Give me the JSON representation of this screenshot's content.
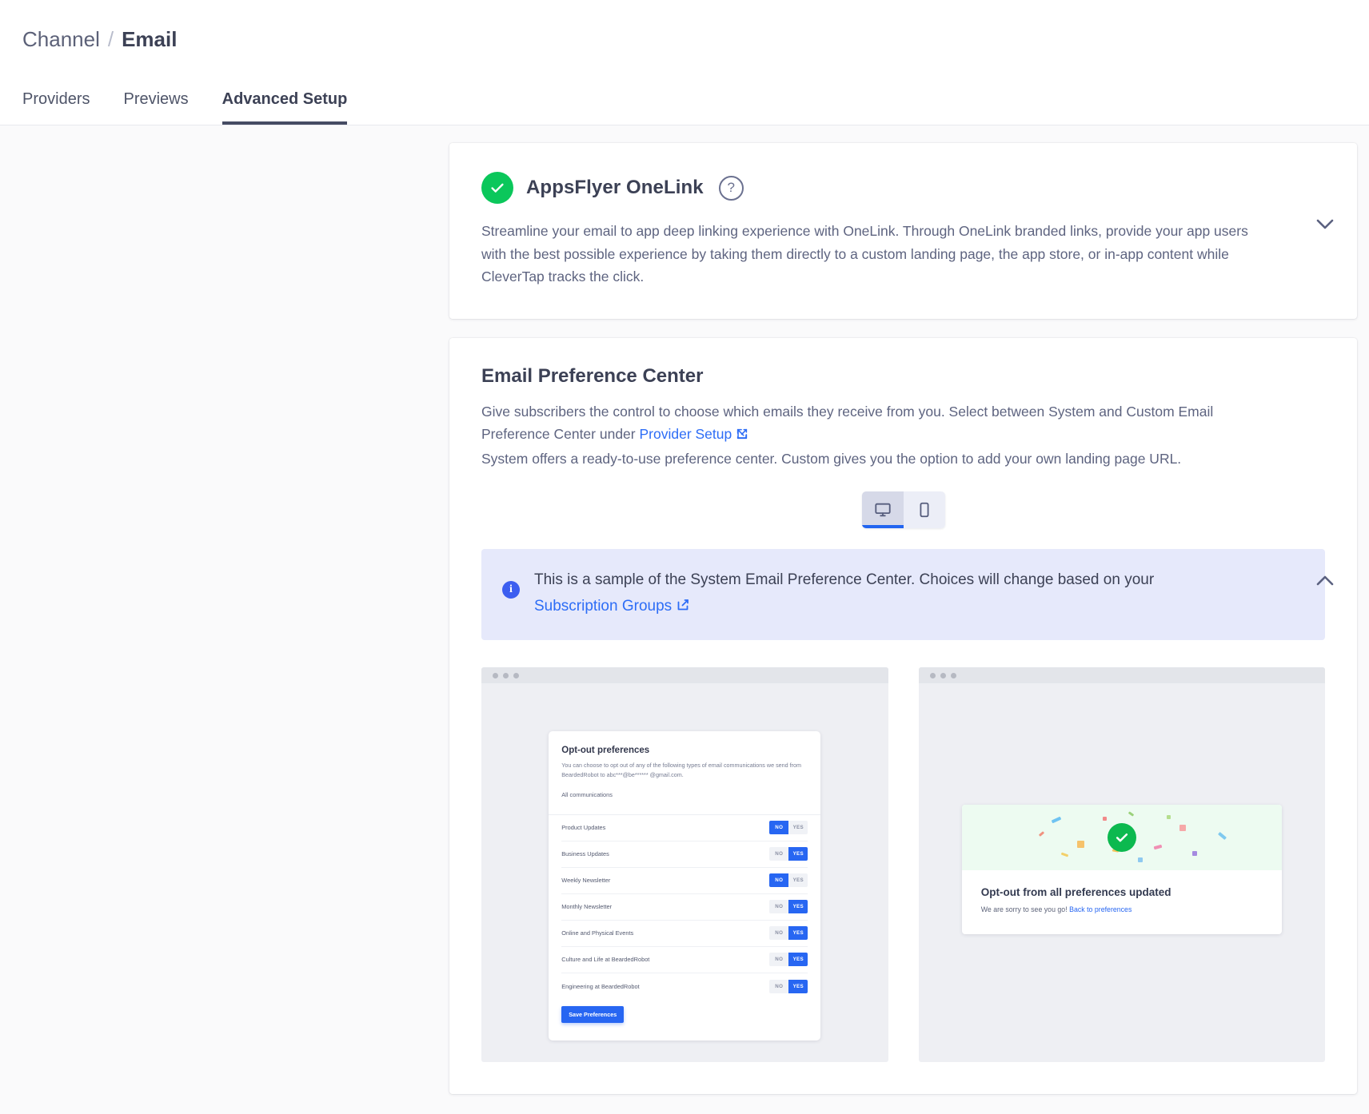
{
  "breadcrumb": {
    "parent": "Channel",
    "separator": "/",
    "current": "Email"
  },
  "tabs": [
    {
      "label": "Providers",
      "active": false
    },
    {
      "label": "Previews",
      "active": false
    },
    {
      "label": "Advanced Setup",
      "active": true
    }
  ],
  "onelink": {
    "title": "AppsFlyer OneLink",
    "help_label": "?",
    "status_icon": "check-circle-icon",
    "description": "Streamline your email to app deep linking experience with OneLink. Through OneLink branded links, provide your app users with the best possible experience by taking them directly to a custom landing page, the app store, or in-app content while CleverTap tracks the click.",
    "collapse_icon": "chevron-down-icon"
  },
  "preference_center": {
    "title": "Email Preference Center",
    "desc_part1": "Give subscribers the control to choose which emails they receive from you. Select between System and Custom Email Preference Center under ",
    "provider_setup_link": "Provider Setup",
    "desc_part2": "System offers a ready-to-use preference center. Custom gives you the option to add your own landing page URL.",
    "collapse_icon": "chevron-up-icon",
    "device_toggle": [
      {
        "name": "desktop",
        "icon": "monitor-icon",
        "active": true
      },
      {
        "name": "mobile",
        "icon": "mobile-icon",
        "active": false
      }
    ],
    "info_banner": {
      "icon": "info-icon",
      "text": "This is a sample of the System Email Preference Center. Choices will change based on your ",
      "link": "Subscription Groups"
    }
  },
  "preview_left": {
    "window_dots": 3,
    "heading": "Opt-out preferences",
    "description": "You can choose to opt out of any of the following types of email communications we send from BeardedRobot to abc***@be****** @gmail.com.",
    "group_label": "All communications",
    "toggle_labels": {
      "off": "NO",
      "on": "YES"
    },
    "rows": [
      {
        "label": "Product Updates",
        "value": "NO"
      },
      {
        "label": "Business Updates",
        "value": "YES"
      },
      {
        "label": "Weekly Newsletter",
        "value": "NO"
      },
      {
        "label": "Monthly Newsletter",
        "value": "YES"
      },
      {
        "label": "Online and Physical  Events",
        "value": "YES"
      },
      {
        "label": "Culture and Life at BeardedRobot",
        "value": "YES"
      },
      {
        "label": "Engineering at BeardedRobot",
        "value": "YES"
      }
    ],
    "save_label": "Save Preferences"
  },
  "preview_right": {
    "window_dots": 3,
    "success_icon": "check-circle-icon",
    "heading": "Opt-out from all preferences updated",
    "subtext": "We are sorry to see you go!",
    "link": "Back to preferences"
  },
  "colors": {
    "accent_blue": "#2766f2",
    "link_blue": "#2d6df6",
    "success_green": "#0bc75b",
    "text_dark": "#3c4155",
    "text_muted": "#5e6480",
    "info_bg": "#e6e9fb",
    "page_bg": "#fafafb"
  }
}
